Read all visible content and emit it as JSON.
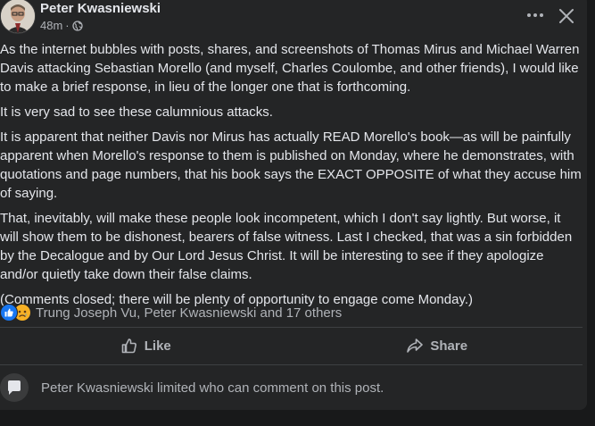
{
  "post": {
    "author": "Peter Kwasniewski",
    "time": "48m",
    "separator": "·",
    "paragraphs": [
      "As the internet bubbles with posts, shares, and screenshots of Thomas Mirus and Michael Warren Davis attacking Sebastian Morello (and myself, Charles Coulombe, and other friends), I would like to make a brief response, in lieu of the longer one that is forthcoming.",
      "It is very sad to see these calumnious attacks.",
      "It is apparent that neither Davis nor Mirus has actually READ Morello's book—as will be painfully apparent when Morello's response to them is published on Monday, where he demonstrates, with quotations and page numbers, that his book says the EXACT OPPOSITE of what they accuse him of saying.",
      "That, inevitably, will make these people look incompetent, which I don't say lightly. But worse, it will show them to be dishonest, bearers of false witness. Last I checked, that was a sin forbidden by the Decalogue and by Our Lord Jesus Christ. It will be interesting to see if they apologize and/or quietly take down their false claims.",
      "(Comments closed; there will be plenty of opportunity to engage come Monday.)"
    ]
  },
  "reactions": {
    "summary": "Trung Joseph Vu, Peter Kwasniewski and 17 others",
    "like_color": "#1877f2",
    "sad_color": "#f7b125"
  },
  "actions": {
    "like_label": "Like",
    "share_label": "Share"
  },
  "comments": {
    "notice": "Peter Kwasniewski limited who can comment on this post."
  },
  "icons": [
    "more-icon",
    "close-icon",
    "globe-icon",
    "like-icon",
    "share-icon",
    "like-reaction-icon",
    "sad-reaction-icon",
    "user-avatar-icon"
  ]
}
